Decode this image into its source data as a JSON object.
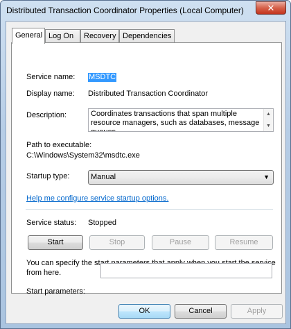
{
  "window": {
    "title": "Distributed Transaction Coordinator Properties (Local Computer)",
    "close_glyph": "✕"
  },
  "tabs": [
    {
      "label": "General",
      "active": true
    },
    {
      "label": "Log On",
      "active": false
    },
    {
      "label": "Recovery",
      "active": false
    },
    {
      "label": "Dependencies",
      "active": false
    }
  ],
  "general": {
    "service_name_label": "Service name:",
    "service_name_value": "MSDTC",
    "display_name_label": "Display name:",
    "display_name_value": "Distributed Transaction Coordinator",
    "description_label": "Description:",
    "description_value": "Coordinates transactions that span multiple resource managers, such as databases, message queues,",
    "path_label": "Path to executable:",
    "path_value": "C:\\Windows\\System32\\msdtc.exe",
    "startup_type_label": "Startup type:",
    "startup_type_value": "Manual",
    "help_link": "Help me configure service startup options.",
    "status_label": "Service status:",
    "status_value": "Stopped",
    "buttons": {
      "start": "Start",
      "stop": "Stop",
      "pause": "Pause",
      "resume": "Resume"
    },
    "params_note": "You can specify the start parameters that apply when you start the service from here.",
    "params_label": "Start parameters:",
    "params_value": ""
  },
  "footer": {
    "ok": "OK",
    "cancel": "Cancel",
    "apply": "Apply"
  }
}
